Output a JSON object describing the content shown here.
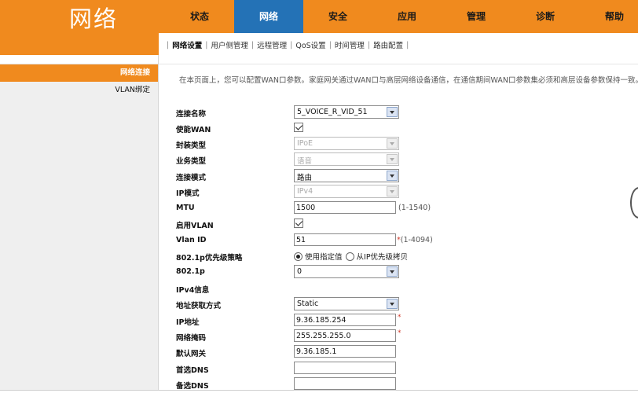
{
  "brand": {
    "title": "网络",
    "color": "#f08a1e"
  },
  "nav": {
    "items": [
      {
        "label": "状态"
      },
      {
        "label": "网络"
      },
      {
        "label": "安全"
      },
      {
        "label": "应用"
      },
      {
        "label": "管理"
      },
      {
        "label": "诊断"
      },
      {
        "label": "帮助"
      }
    ],
    "active_color": "#2472b6"
  },
  "subnav": {
    "items": [
      "网络设置",
      "用户侧管理",
      "远程管理",
      "QoS设置",
      "时间管理",
      "路由配置"
    ],
    "separator": "|"
  },
  "leftmenu": {
    "items": [
      "网络连接",
      "VLAN绑定"
    ]
  },
  "intro": "在本页面上，您可以配置WAN口参数。家庭网关通过WAN口与高层网络设备通信，在通信期间WAN口参数集必须和高层设备参数保持一致。",
  "form": {
    "conn_name": {
      "label": "连接名称",
      "value": "5_VOICE_R_VID_51"
    },
    "enable_wan": {
      "label": "使能WAN",
      "checked": true
    },
    "encap": {
      "label": "封装类型",
      "value": "IPoE"
    },
    "service": {
      "label": "业务类型",
      "value": "语音"
    },
    "conn_mode": {
      "label": "连接模式",
      "value": "路由"
    },
    "ip_mode": {
      "label": "IP模式",
      "value": "IPv4"
    },
    "mtu": {
      "label": "MTU",
      "value": "1500",
      "hint": "(1-1540)"
    },
    "enable_vlan": {
      "label": "启用VLAN",
      "checked": true
    },
    "vlan_id": {
      "label": "Vlan ID",
      "value": "51",
      "required": "*",
      "hint": "(1-4094)"
    },
    "priority_policy": {
      "label": "802.1p优先级策略",
      "option1": "使用指定值",
      "option2": "从IP优先级拷贝",
      "selected": "使用指定值"
    },
    "dot1p": {
      "label": "802.1p",
      "value": "0"
    },
    "ipv4_info": {
      "label": "IPv4信息"
    },
    "addr_method": {
      "label": "地址获取方式",
      "value": "Static"
    },
    "ip_addr": {
      "label": "IP地址",
      "value": "9.36.185.254",
      "required": "*"
    },
    "netmask": {
      "label": "网络掩码",
      "value": "255.255.255.0",
      "required": "*"
    },
    "gateway": {
      "label": "默认网关",
      "value": "9.36.185.1"
    },
    "dns1": {
      "label": "首选DNS",
      "value": ""
    },
    "dns2": {
      "label": "备选DNS",
      "value": ""
    }
  }
}
